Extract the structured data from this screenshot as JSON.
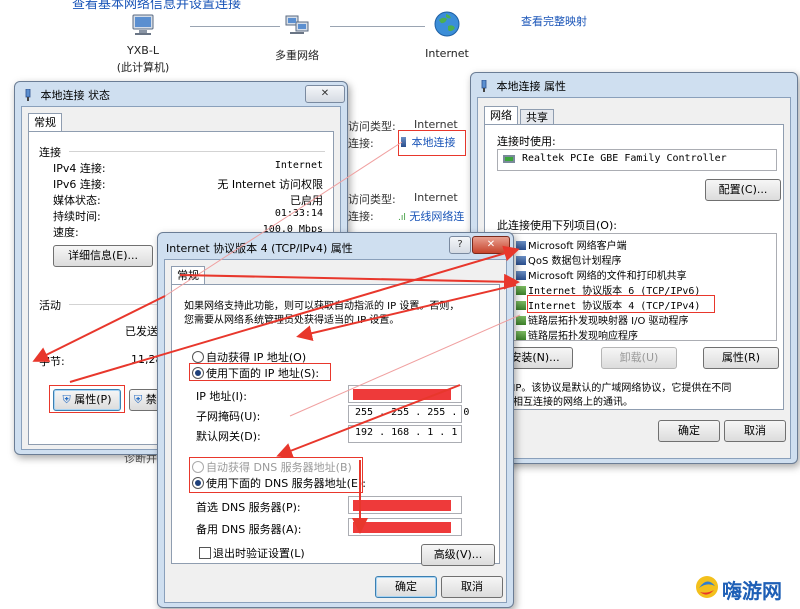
{
  "background": {
    "top_link_text": "查看基本网络信息并设置连接",
    "nodes": [
      {
        "name": "YXB-L",
        "sub": "(此计算机)"
      },
      {
        "name": "多重网络",
        "sub": ""
      },
      {
        "name": "Internet",
        "sub": ""
      }
    ],
    "full_map_link": "查看完整映射",
    "conn1": {
      "access_type_label": "访问类型:",
      "access_type_value": "Internet",
      "conn_label": "连接:",
      "conn_value": "本地连接"
    },
    "conn2": {
      "access_type_label": "访问类型:",
      "access_type_value": "Internet",
      "conn_label": "连接:",
      "conn_value": "无线网络连"
    },
    "partial_text": "诊断并"
  },
  "status_window": {
    "title": "本地连接 状态",
    "tab": "常规",
    "connection_group": "连接",
    "rows": [
      {
        "label": "IPv4 连接:",
        "value": "Internet"
      },
      {
        "label": "IPv6 连接:",
        "value": "无 Internet 访问权限"
      },
      {
        "label": "媒体状态:",
        "value": "已启用"
      },
      {
        "label": "持续时间:",
        "value": "01:33:14"
      },
      {
        "label": "速度:",
        "value": "100.0 Mbps"
      }
    ],
    "details_button": "详细信息(E)...",
    "activity_group": "活动",
    "sent_label": "已发送",
    "bytes_label": "字节:",
    "bytes_value": "11,28",
    "properties_button": "属性(P)",
    "disable_button": "禁用"
  },
  "props_window": {
    "title": "本地连接 属性",
    "tabs": [
      "网络",
      "共享"
    ],
    "connect_using_label": "连接时使用:",
    "adapter": "Realtek PCIe GBE Family Controller",
    "configure_button": "配置(C)...",
    "items_label": "此连接使用下列项目(O):",
    "items": [
      {
        "checked": true,
        "label": "Microsoft 网络客户端"
      },
      {
        "checked": true,
        "label": "QoS 数据包计划程序"
      },
      {
        "checked": true,
        "label": "Microsoft 网络的文件和打印机共享"
      },
      {
        "checked": true,
        "label": "Internet 协议版本 6 (TCP/IPv6)"
      },
      {
        "checked": true,
        "label": "Internet 协议版本 4 (TCP/IPv4)"
      },
      {
        "checked": true,
        "label": "链路层拓扑发现映射器 I/O 驱动程序"
      },
      {
        "checked": true,
        "label": "链路层拓扑发现响应程序"
      }
    ],
    "install_button": "安装(N)...",
    "uninstall_button": "卸载(U)",
    "properties_button": "属性(R)",
    "description_line1": "P/IP。该协议是默认的广域网络协议，它提供在不同",
    "description_line2": "的相互连接的网络上的通讯。",
    "ok_button": "确定",
    "cancel_button": "取消"
  },
  "ipv4_window": {
    "title": "Internet 协议版本 4 (TCP/IPv4) 属性",
    "help_button": "?",
    "tab": "常规",
    "intro_line1": "如果网络支持此功能，则可以获取自动指派的 IP 设置。否则，",
    "intro_line2": "您需要从网络系统管理员处获得适当的 IP 设置。",
    "auto_ip_label": "自动获得 IP 地址(O)",
    "use_ip_label": "使用下面的 IP 地址(S):",
    "ip_label": "IP 地址(I):",
    "subnet_label": "子网掩码(U):",
    "subnet_value": "255 . 255 . 255 . 0",
    "gateway_label": "默认网关(D):",
    "gateway_value": "192 . 168 . 1 . 1",
    "auto_dns_label": "自动获得 DNS 服务器地址(B)",
    "use_dns_label": "使用下面的 DNS 服务器地址(E):",
    "preferred_dns_label": "首选 DNS 服务器(P):",
    "alternate_dns_label": "备用 DNS 服务器(A):",
    "validate_label": "退出时验证设置(L)",
    "advanced_button": "高级(V)...",
    "ok_button": "确定",
    "cancel_button": "取消"
  },
  "watermark": {
    "text": "嗨游网"
  },
  "colors": {
    "highlight_red": "#e8372c",
    "redacted": "#ee3a3a",
    "link_blue": "#1a55b8"
  }
}
